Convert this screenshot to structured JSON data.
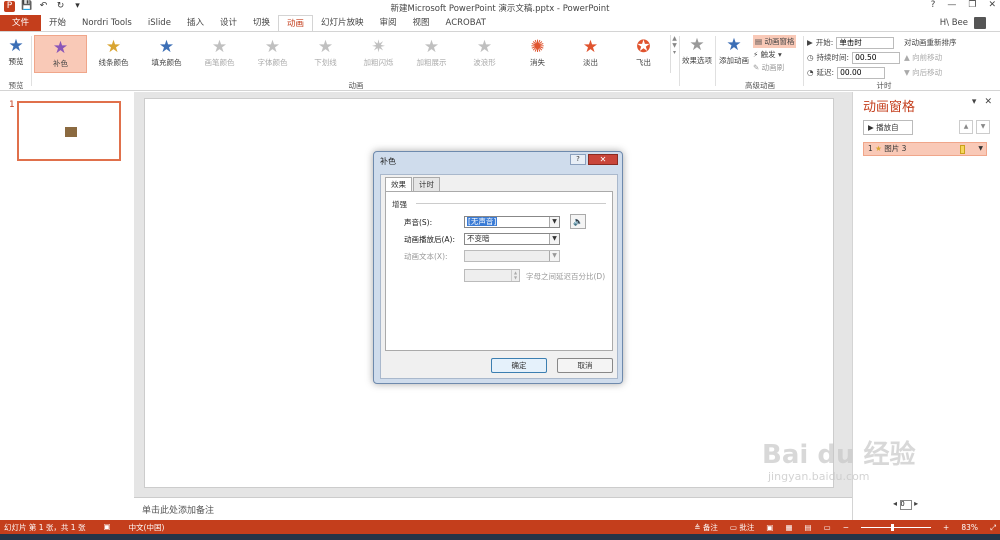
{
  "titlebar": {
    "title": "新建Microsoft PowerPoint 演示文稿.pptx - PowerPoint",
    "help": "?",
    "minimize": "—",
    "restore": "❐",
    "close": "✕"
  },
  "tabs": [
    {
      "label": "文件"
    },
    {
      "label": "开始"
    },
    {
      "label": "Nordri Tools"
    },
    {
      "label": "iSlide"
    },
    {
      "label": "插入"
    },
    {
      "label": "设计"
    },
    {
      "label": "切换"
    },
    {
      "label": "动画"
    },
    {
      "label": "幻灯片放映"
    },
    {
      "label": "审阅"
    },
    {
      "label": "视图"
    },
    {
      "label": "ACROBAT"
    }
  ],
  "user": {
    "name": "H\\ Bee"
  },
  "ribbon": {
    "preview_label": "预览",
    "preview_group": "预览",
    "animation_group": "动画",
    "advanced_group": "高级动画",
    "timing_group": "计时",
    "gallery": [
      {
        "label": "补色",
        "color": "#8a56b8"
      },
      {
        "label": "线条颜色",
        "color": "#d9a532"
      },
      {
        "label": "填充颜色",
        "color": "#3c6fb6"
      },
      {
        "label": "画笔颜色",
        "color": "#b0b0b0"
      },
      {
        "label": "字体颜色",
        "color": "#b0b0b0"
      },
      {
        "label": "下划线",
        "color": "#b0b0b0"
      },
      {
        "label": "加粗闪烁",
        "color": "#b0b0b0"
      },
      {
        "label": "加粗展示",
        "color": "#b0b0b0"
      },
      {
        "label": "波浪形",
        "color": "#b0b0b0"
      },
      {
        "label": "消失",
        "color": "#e0542f"
      },
      {
        "label": "淡出",
        "color": "#e0542f"
      },
      {
        "label": "飞出",
        "color": "#e0542f"
      }
    ],
    "effect_options": "效果选项",
    "add_animation": "添加动画",
    "anim_pane_btn": "动画窗格",
    "trigger": "触发",
    "anim_painter": "动画刷",
    "start_label": "开始:",
    "start_value": "单击时",
    "duration_label": "持续时间:",
    "duration_value": "00.50",
    "delay_label": "延迟:",
    "delay_value": "00.00",
    "reorder_title": "对动画重新排序",
    "move_earlier": "向前移动",
    "move_later": "向后移动"
  },
  "slides": {
    "number": "1"
  },
  "notes": {
    "placeholder": "单击此处添加备注"
  },
  "anim_pane": {
    "title": "动画窗格",
    "play_from": "播放自",
    "item_number": "1",
    "item_name": "图片 3",
    "page_value": "0"
  },
  "dialog": {
    "title": "补色",
    "help": "?",
    "close": "✕",
    "tab_effect": "效果",
    "tab_timing": "计时",
    "section": "增强",
    "sound_label": "声音(S):",
    "sound_value": "[无声音]",
    "after_label": "动画播放后(A):",
    "after_value": "不变暗",
    "text_label": "动画文本(X):",
    "text_value": "",
    "delay_pct_label": "字母之间延迟百分比(D)",
    "ok": "确定",
    "cancel": "取消"
  },
  "status": {
    "slide_info": "幻灯片 第 1 张，共 1 张",
    "language": "中文(中国)",
    "notes": "备注",
    "comments": "批注",
    "zoom": "83%"
  },
  "watermark": {
    "text": "Bai du 经验",
    "sub": "jingyan.baidu.com"
  },
  "colors": {
    "accent": "#c43e1c",
    "highlight": "#f9c9b7"
  }
}
